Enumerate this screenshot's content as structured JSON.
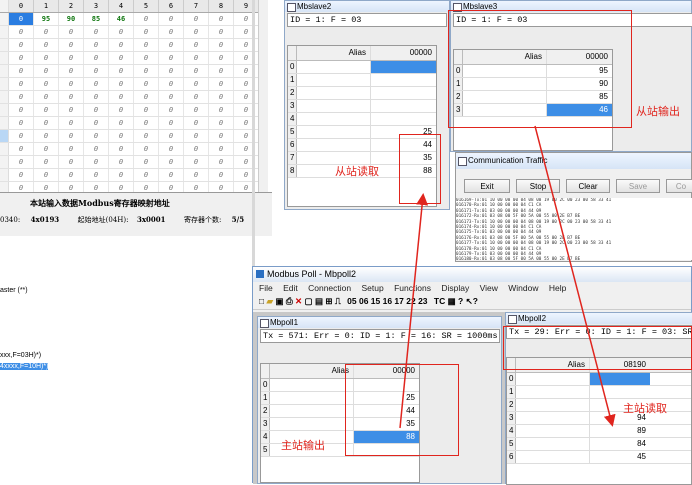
{
  "left_app": {
    "col_headers": [
      "0",
      "1",
      "2",
      "3",
      "4",
      "5",
      "6",
      "7",
      "8",
      "9"
    ],
    "first_row": [
      "0",
      "95",
      "90",
      "85",
      "46",
      "0",
      "0",
      "0",
      "0",
      "0"
    ],
    "empty_cell": "0",
    "info_title": "本站输入数据Modbus寄存器映射地址",
    "info_row": {
      "prefix": "0340:",
      "addr1": "4x0193",
      "label2": "起始地址(04H):",
      "addr2": "3x0001",
      "label3": "寄存器个数:",
      "count": "5/5"
    },
    "text_lines": [
      "aster (**)",
      "xxx,F=03H)*)",
      "4xxxx,F=10H)*)"
    ]
  },
  "slave2": {
    "title": "Mbslave2",
    "status": "ID = 1: F = 03",
    "header_alias": "Alias",
    "header_value": "00000",
    "rows": [
      {
        "idx": "0",
        "value": ""
      },
      {
        "idx": "1",
        "value": ""
      },
      {
        "idx": "2",
        "value": ""
      },
      {
        "idx": "3",
        "value": ""
      },
      {
        "idx": "4",
        "value": ""
      },
      {
        "idx": "5",
        "value": "25"
      },
      {
        "idx": "6",
        "value": "44"
      },
      {
        "idx": "7",
        "value": "35"
      },
      {
        "idx": "8",
        "value": "88"
      }
    ],
    "annotation": "从站读取"
  },
  "slave3": {
    "title": "Mbslave3",
    "status": "ID = 1: F = 03",
    "header_alias": "Alias",
    "header_value": "00000",
    "rows": [
      {
        "idx": "0",
        "value": "95"
      },
      {
        "idx": "1",
        "value": "90"
      },
      {
        "idx": "2",
        "value": "85"
      },
      {
        "idx": "3",
        "value": "46"
      }
    ],
    "annotation": "从站输出"
  },
  "comm": {
    "title": "Communication Traffic",
    "buttons": [
      "Exit",
      "Stop",
      "Clear",
      "Save",
      "Co"
    ],
    "log": [
      "016169-Tx:01 10 00 00 00 04 08 00 19 00 2C 00 23 00 58 33 41",
      "016170-Rx:01 10 00 00 00 04 C1 CA",
      "016171-Tx:01 03 00 00 00 04 44 09",
      "016172-Rx:01 03 08 00 5F 00 5A 00 55 00 2E B7 BE",
      "016173-Tx:01 10 00 00 00 04 08 00 19 00 2C 00 23 00 58 33 41",
      "016174-Rx:01 10 00 00 00 04 C1 CA",
      "016175-Tx:01 03 00 00 00 04 44 09",
      "016176-Rx:01 03 08 00 5F 00 5A 00 55 00 2E B7 BE",
      "016177-Tx:01 10 00 00 00 04 08 00 19 00 2C 00 23 00 58 33 41",
      "016178-Rx:01 10 00 00 00 04 C1 CA",
      "016179-Tx:01 03 00 00 00 04 44 09",
      "016180-Rx:01 03 08 00 5F 00 5A 00 55 00 2E B7 BE",
      "016181-Tx:01 10 00 00 00 04 08 00 19 00 2C 00 23 00 58 33 41"
    ]
  },
  "poll_app": {
    "title": "Modbus Poll - Mbpoll2",
    "menu": [
      "File",
      "Edit",
      "Connection",
      "Setup",
      "Functions",
      "Display",
      "View",
      "Window",
      "Help"
    ],
    "toolbar_codes": "05 06 15 16 17 22 23",
    "toolbar_tc": "TC"
  },
  "poll1": {
    "title": "Mbpoll1",
    "status": "Tx = 571: Err = 0: ID = 1: F = 16: SR = 1000ms",
    "header_alias": "Alias",
    "header_value": "00000",
    "rows": [
      {
        "idx": "0",
        "value": ""
      },
      {
        "idx": "1",
        "value": "25"
      },
      {
        "idx": "2",
        "value": "44"
      },
      {
        "idx": "3",
        "value": "35"
      },
      {
        "idx": "4",
        "value": "88"
      },
      {
        "idx": "5",
        "value": ""
      }
    ],
    "annotation": "主站输出"
  },
  "poll2": {
    "title": "Mbpoll2",
    "status": "Tx = 29: Err = 0: ID = 1: F = 03: SR = 1000ms",
    "header_alias": "Alias",
    "header_value": "08190",
    "rows": [
      {
        "idx": "0",
        "value": ""
      },
      {
        "idx": "1",
        "value": ""
      },
      {
        "idx": "2",
        "value": ""
      },
      {
        "idx": "3",
        "value": "94"
      },
      {
        "idx": "4",
        "value": "89"
      },
      {
        "idx": "5",
        "value": "84"
      },
      {
        "idx": "6",
        "value": "45"
      }
    ],
    "annotation": "主站读取"
  },
  "colors": {
    "annotation_red": "#e0251e",
    "selection_blue": "#3d8ee6"
  }
}
